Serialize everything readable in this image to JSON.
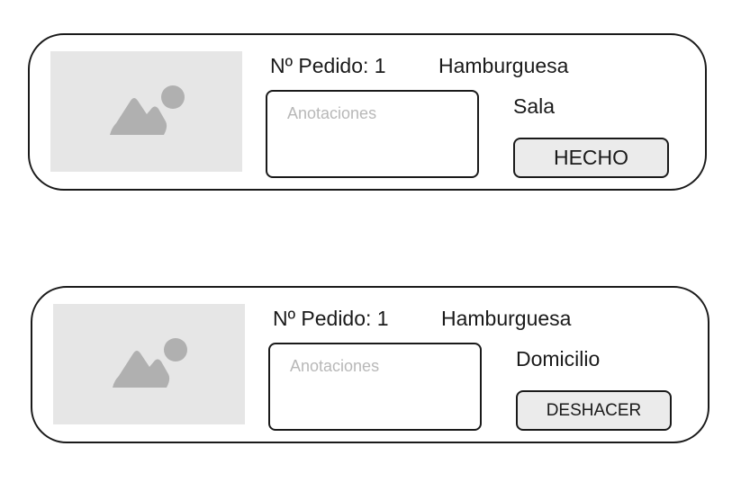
{
  "orders": [
    {
      "order_label": "Nº Pedido: 1",
      "dish": "Hamburguesa",
      "notes_placeholder": "Anotaciones",
      "location": "Sala",
      "action_label": "HECHO",
      "image_icon": "image-placeholder-icon"
    },
    {
      "order_label": "Nº Pedido: 1",
      "dish": "Hamburguesa",
      "notes_placeholder": "Anotaciones",
      "location": "Domicilio",
      "action_label": "DESHACER",
      "image_icon": "image-placeholder-icon"
    }
  ],
  "colors": {
    "border": "#1a1a1a",
    "image_bg": "#e6e6e6",
    "image_icon": "#b0b0b0",
    "placeholder_text": "#b8b8b8",
    "button_bg": "#ebebeb"
  }
}
